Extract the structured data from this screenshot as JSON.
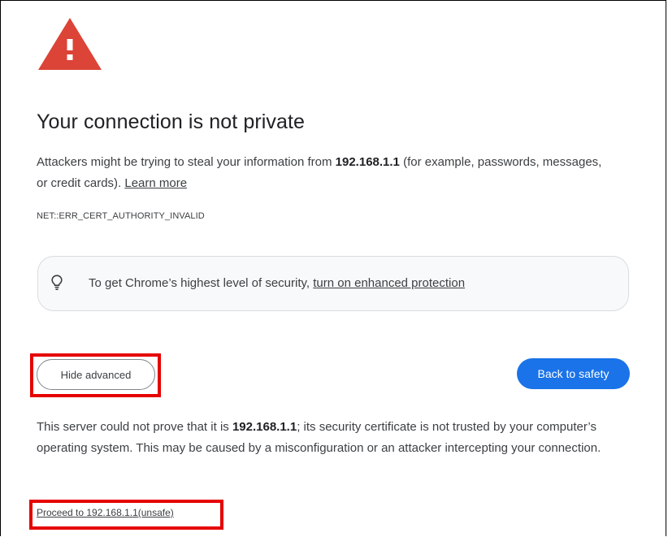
{
  "interstitial": {
    "title": "Your connection is not private",
    "description": {
      "prefix": "Attackers might be trying to steal your information from ",
      "host": "192.168.1.1",
      "suffix": " (for example, passwords, messages, or credit cards). ",
      "learn_more": "Learn more"
    },
    "error_code": "NET::ERR_CERT_AUTHORITY_INVALID",
    "enhanced_protection": {
      "icon": "lightbulb-icon",
      "prefix": "To get Chrome’s highest level of security, ",
      "link": "turn on enhanced protection"
    },
    "buttons": {
      "hide_advanced": "Hide advanced",
      "back_to_safety": "Back to safety"
    },
    "details": {
      "prefix": "This server could not prove that it is ",
      "host": "192.168.1.1",
      "suffix": "; its security certificate is not trusted by your computer’s operating system. This may be caused by a misconfiguration or an attacker intercepting your connection."
    },
    "proceed_link": "Proceed to 192.168.1.1(unsafe)",
    "colors": {
      "warning_red": "#db4437",
      "primary_blue": "#1a73e8",
      "annotation_red": "#e60000"
    }
  }
}
